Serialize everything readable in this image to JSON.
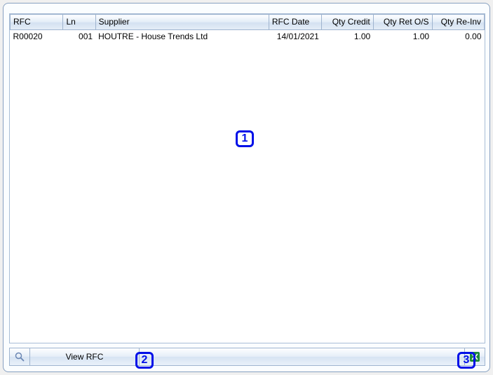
{
  "grid": {
    "headers": {
      "rfc": "RFC",
      "ln": "Ln",
      "supplier": "Supplier",
      "rfc_date": "RFC Date",
      "qty_credit": "Qty Credit",
      "qty_ret_os": "Qty Ret O/S",
      "qty_reinv": "Qty Re-Inv"
    },
    "rows": [
      {
        "rfc": "R00020",
        "ln": "001",
        "supplier": "HOUTRE - House Trends Ltd",
        "rfc_date": "14/01/2021",
        "qty_credit": "1.00",
        "qty_ret_os": "1.00",
        "qty_reinv": "0.00"
      }
    ]
  },
  "toolbar": {
    "view_label": "View RFC"
  },
  "markers": {
    "m1": "1",
    "m2": "2",
    "m3": "3"
  }
}
